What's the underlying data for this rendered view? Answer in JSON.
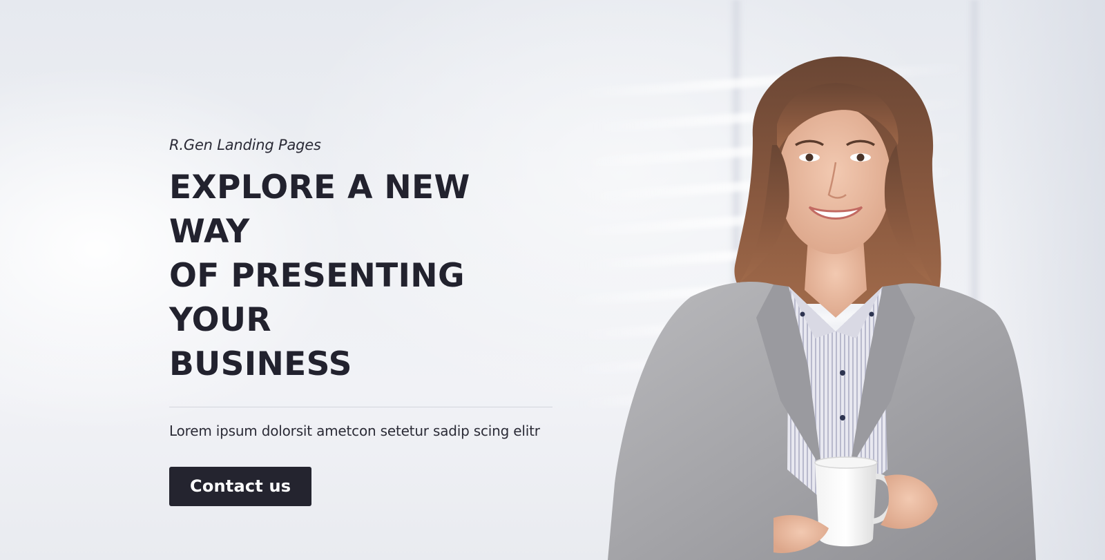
{
  "hero": {
    "eyebrow": "R.Gen Landing Pages",
    "headline_lines": [
      "EXPLORE A NEW WAY",
      "OF PRESENTING YOUR",
      "BUSINESS"
    ],
    "lead": "Lorem ipsum dolorsit ametcon setetur sadip scing elitr",
    "cta_label": "Contact us"
  },
  "colors": {
    "heading": "#22222e",
    "button_bg": "#24242f",
    "button_text": "#ffffff",
    "background": "#eceef3"
  },
  "image": {
    "subject": "businesswoman-holding-coffee-cup"
  }
}
